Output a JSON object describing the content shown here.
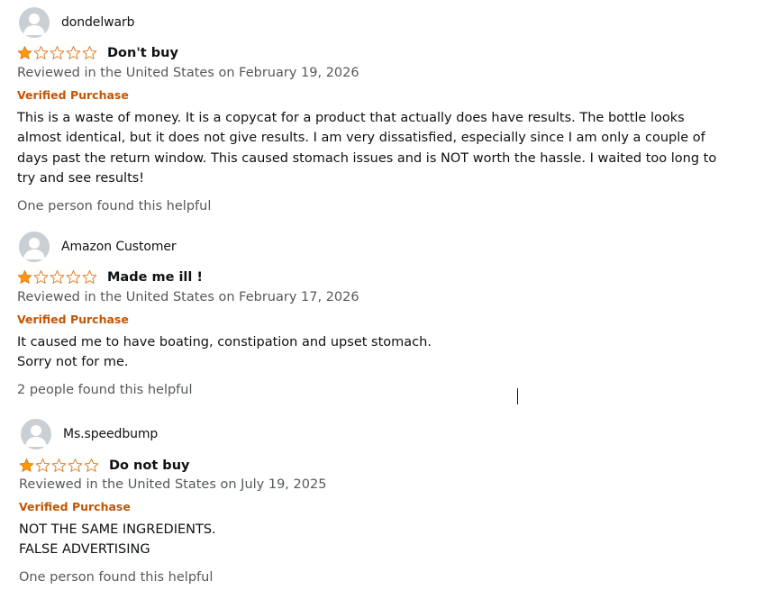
{
  "colors": {
    "star_fill": "#ff9900",
    "star_outline": "#de7921",
    "verified": "#c45500",
    "meta_text": "#565959",
    "avatar_bg": "#c9cfd3"
  },
  "reviews": [
    {
      "profile_name": "dondelwarb",
      "avatar_icon": "default-user-avatar-icon",
      "rating": 1,
      "rating_max": 5,
      "title": "Don't buy",
      "date": "Reviewed in the United States on February 19, 2026",
      "verified": "Verified Purchase",
      "body_lines": [
        "This is a waste of money. It is a copycat for a product that actually does have results. The bottle looks",
        "almost identical, but it does not give results. I am very dissatisfied, especially since I am only a couple of",
        "days past the return window. This caused stomach issues and is NOT worth the hassle. I waited too long to",
        "try and see results!"
      ],
      "helpful": "One person found this helpful"
    },
    {
      "profile_name": "Amazon Customer",
      "avatar_icon": "default-user-avatar-icon",
      "rating": 1,
      "rating_max": 5,
      "title": "Made me ill !",
      "date": "Reviewed in the United States on February 17, 2026",
      "verified": "Verified Purchase",
      "body_lines": [
        "It caused me to have boating, constipation and upset stomach.",
        "Sorry not for me."
      ],
      "helpful": "2 people found this helpful"
    },
    {
      "profile_name": "Ms.speedbump",
      "avatar_icon": "default-user-avatar-icon",
      "rating": 1,
      "rating_max": 5,
      "title": "Do not buy",
      "date": "Reviewed in the United States on July 19, 2025",
      "verified": "Verified Purchase",
      "body_lines": [
        "NOT THE SAME INGREDIENTS.",
        "FALSE ADVERTISING"
      ],
      "helpful": "One person found this helpful"
    }
  ]
}
